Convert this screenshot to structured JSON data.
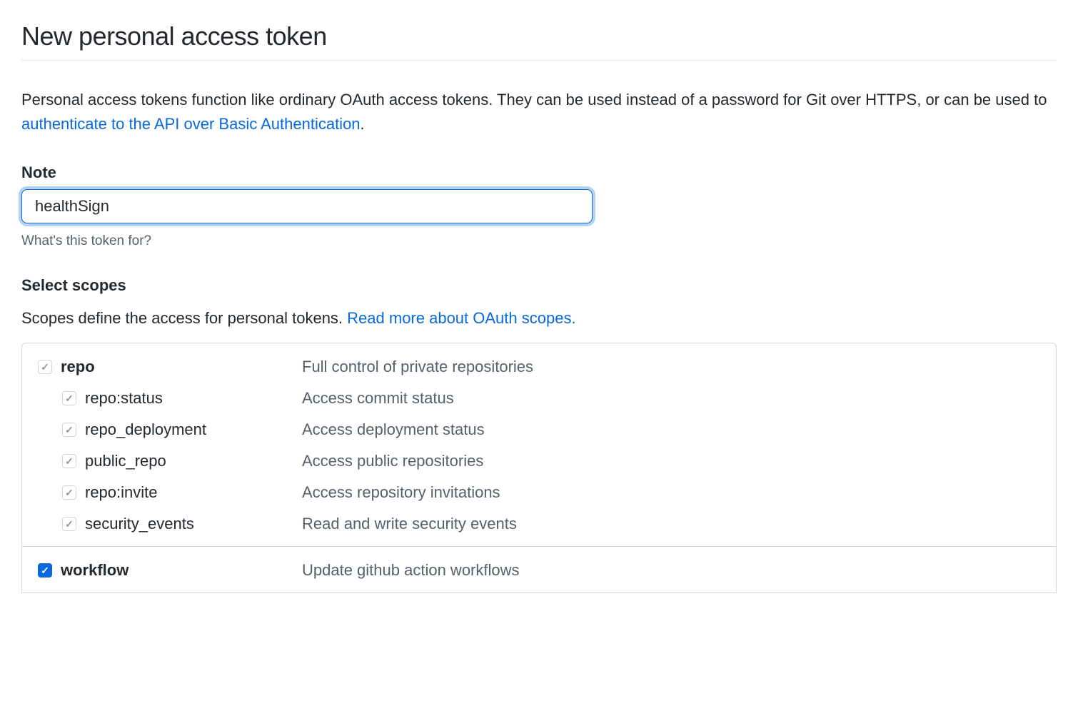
{
  "page": {
    "title": "New personal access token"
  },
  "description": {
    "text_before_link": "Personal access tokens function like ordinary OAuth access tokens. They can be used instead of a password for Git over HTTPS, or can be used to ",
    "link_text": "authenticate to the API over Basic Authentication",
    "text_after_link": "."
  },
  "note_field": {
    "label": "Note",
    "value": "healthSign",
    "hint": "What's this token for?"
  },
  "scopes_section": {
    "heading": "Select scopes",
    "intro_text": "Scopes define the access for personal tokens. ",
    "intro_link": "Read more about OAuth scopes."
  },
  "scopes": {
    "repo": {
      "name": "repo",
      "desc": "Full control of private repositories",
      "children": [
        {
          "name": "repo:status",
          "desc": "Access commit status"
        },
        {
          "name": "repo_deployment",
          "desc": "Access deployment status"
        },
        {
          "name": "public_repo",
          "desc": "Access public repositories"
        },
        {
          "name": "repo:invite",
          "desc": "Access repository invitations"
        },
        {
          "name": "security_events",
          "desc": "Read and write security events"
        }
      ]
    },
    "workflow": {
      "name": "workflow",
      "desc": "Update github action workflows"
    }
  }
}
